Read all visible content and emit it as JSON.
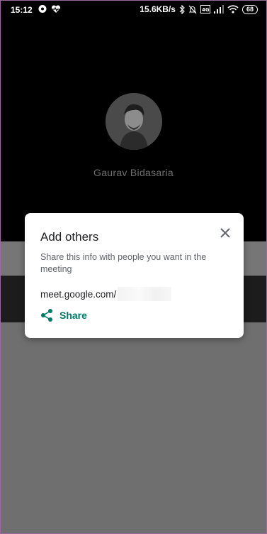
{
  "status_bar": {
    "time": "15:12",
    "network_speed": "15.6KB/s",
    "battery": "68",
    "icons": [
      "chat-bubble-icon",
      "heart-pulse-icon",
      "bluetooth-icon",
      "mute-bell-icon",
      "volte-icon",
      "signal-icon",
      "wifi-icon"
    ]
  },
  "call": {
    "caller_name": "Gaurav Bidasaria"
  },
  "dialog": {
    "title": "Add others",
    "description": "Share this info with people you want in the meeting",
    "meeting_link": "meet.google.com/",
    "share_label": "Share"
  },
  "colors": {
    "accent": "#00796b",
    "overlay": "#6f6f6f",
    "call_background": "#000000"
  }
}
